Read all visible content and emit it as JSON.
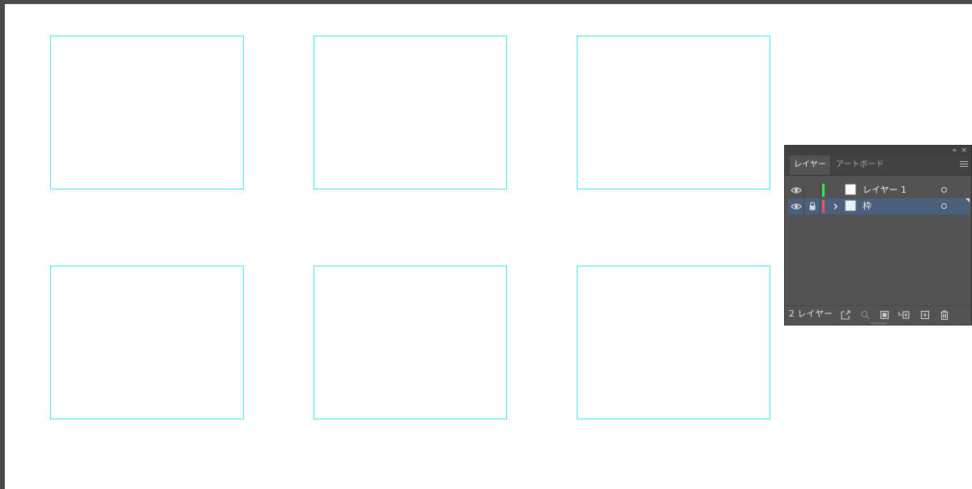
{
  "canvas": {
    "frame_color": "#3ee8f0",
    "frames_count_rows": 2,
    "frames_per_row": 3
  },
  "layers_panel": {
    "tabs": [
      {
        "label": "レイヤー",
        "active": true
      },
      {
        "label": "アートボード",
        "active": false
      }
    ],
    "collapse_icon": "double-chevron-left-icon",
    "close_icon": "close-icon",
    "menu_icon": "hamburger-menu-icon",
    "layers": [
      {
        "name": "レイヤー 1",
        "visible": true,
        "locked": false,
        "color": "#3de64a",
        "expandable": false,
        "selected": false
      },
      {
        "name": "枠",
        "visible": true,
        "locked": true,
        "color": "#ff4b5a",
        "expandable": true,
        "selected": true
      }
    ],
    "footer": {
      "count_label": "2 レイヤー",
      "icons": [
        "export-icon",
        "search-icon",
        "clip-mask-icon",
        "new-sublayer-icon",
        "new-layer-icon",
        "trash-icon"
      ]
    },
    "colors": {
      "panel_bg": "#535353",
      "selected_row": "#4a607d"
    }
  }
}
